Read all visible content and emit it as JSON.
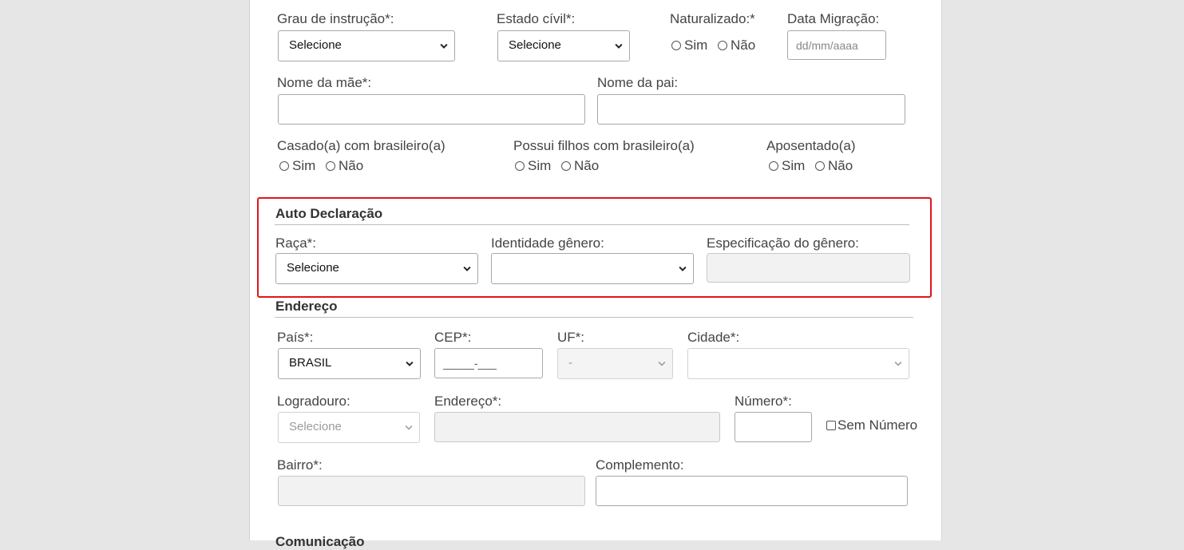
{
  "row1": {
    "grau_label": "Grau de instrução*:",
    "grau_value": "Selecione",
    "estado_label": "Estado cívil*:",
    "estado_value": "Selecione",
    "naturalizado_label": "Naturalizado:*",
    "naturalizado_sim": "Sim",
    "naturalizado_nao": "Não",
    "migracao_label": "Data Migração:",
    "migracao_placeholder": "dd/mm/aaaa"
  },
  "row2": {
    "mae_label": "Nome da mãe*:",
    "pai_label": "Nome da pai:"
  },
  "row3": {
    "casado_label": "Casado(a) com brasileiro(a)",
    "casado_sim": "Sim",
    "casado_nao": "Não",
    "filhos_label": "Possui filhos com brasileiro(a)",
    "filhos_sim": "Sim",
    "filhos_nao": "Não",
    "aposentado_label": "Aposentado(a)",
    "aposentado_sim": "Sim",
    "aposentado_nao": "Não"
  },
  "auto_declaracao": {
    "title": "Auto Declaração",
    "raca_label": "Raça*:",
    "raca_value": "Selecione",
    "identidade_label": "Identidade gênero:",
    "identidade_value": "",
    "especificacao_label": "Especificação do gênero:"
  },
  "endereco": {
    "title": "Endereço",
    "pais_label": "País*:",
    "pais_value": "BRASIL",
    "cep_label": "CEP*:",
    "cep_mask": "_____-___",
    "uf_label": "UF*:",
    "uf_value": "-",
    "cidade_label": "Cidade*:",
    "cidade_value": "",
    "logradouro_label": "Logradouro:",
    "logradouro_value": "Selecione",
    "endereco_label": "Endereço*:",
    "numero_label": "Número*:",
    "sem_numero_label": "Sem Número",
    "bairro_label": "Bairro*:",
    "complemento_label": "Complemento:"
  },
  "comunicacao": {
    "title": "Comunicação"
  },
  "colors": {
    "highlight": "#e0141b",
    "background": "#e6e6e6",
    "card": "#ffffff"
  }
}
